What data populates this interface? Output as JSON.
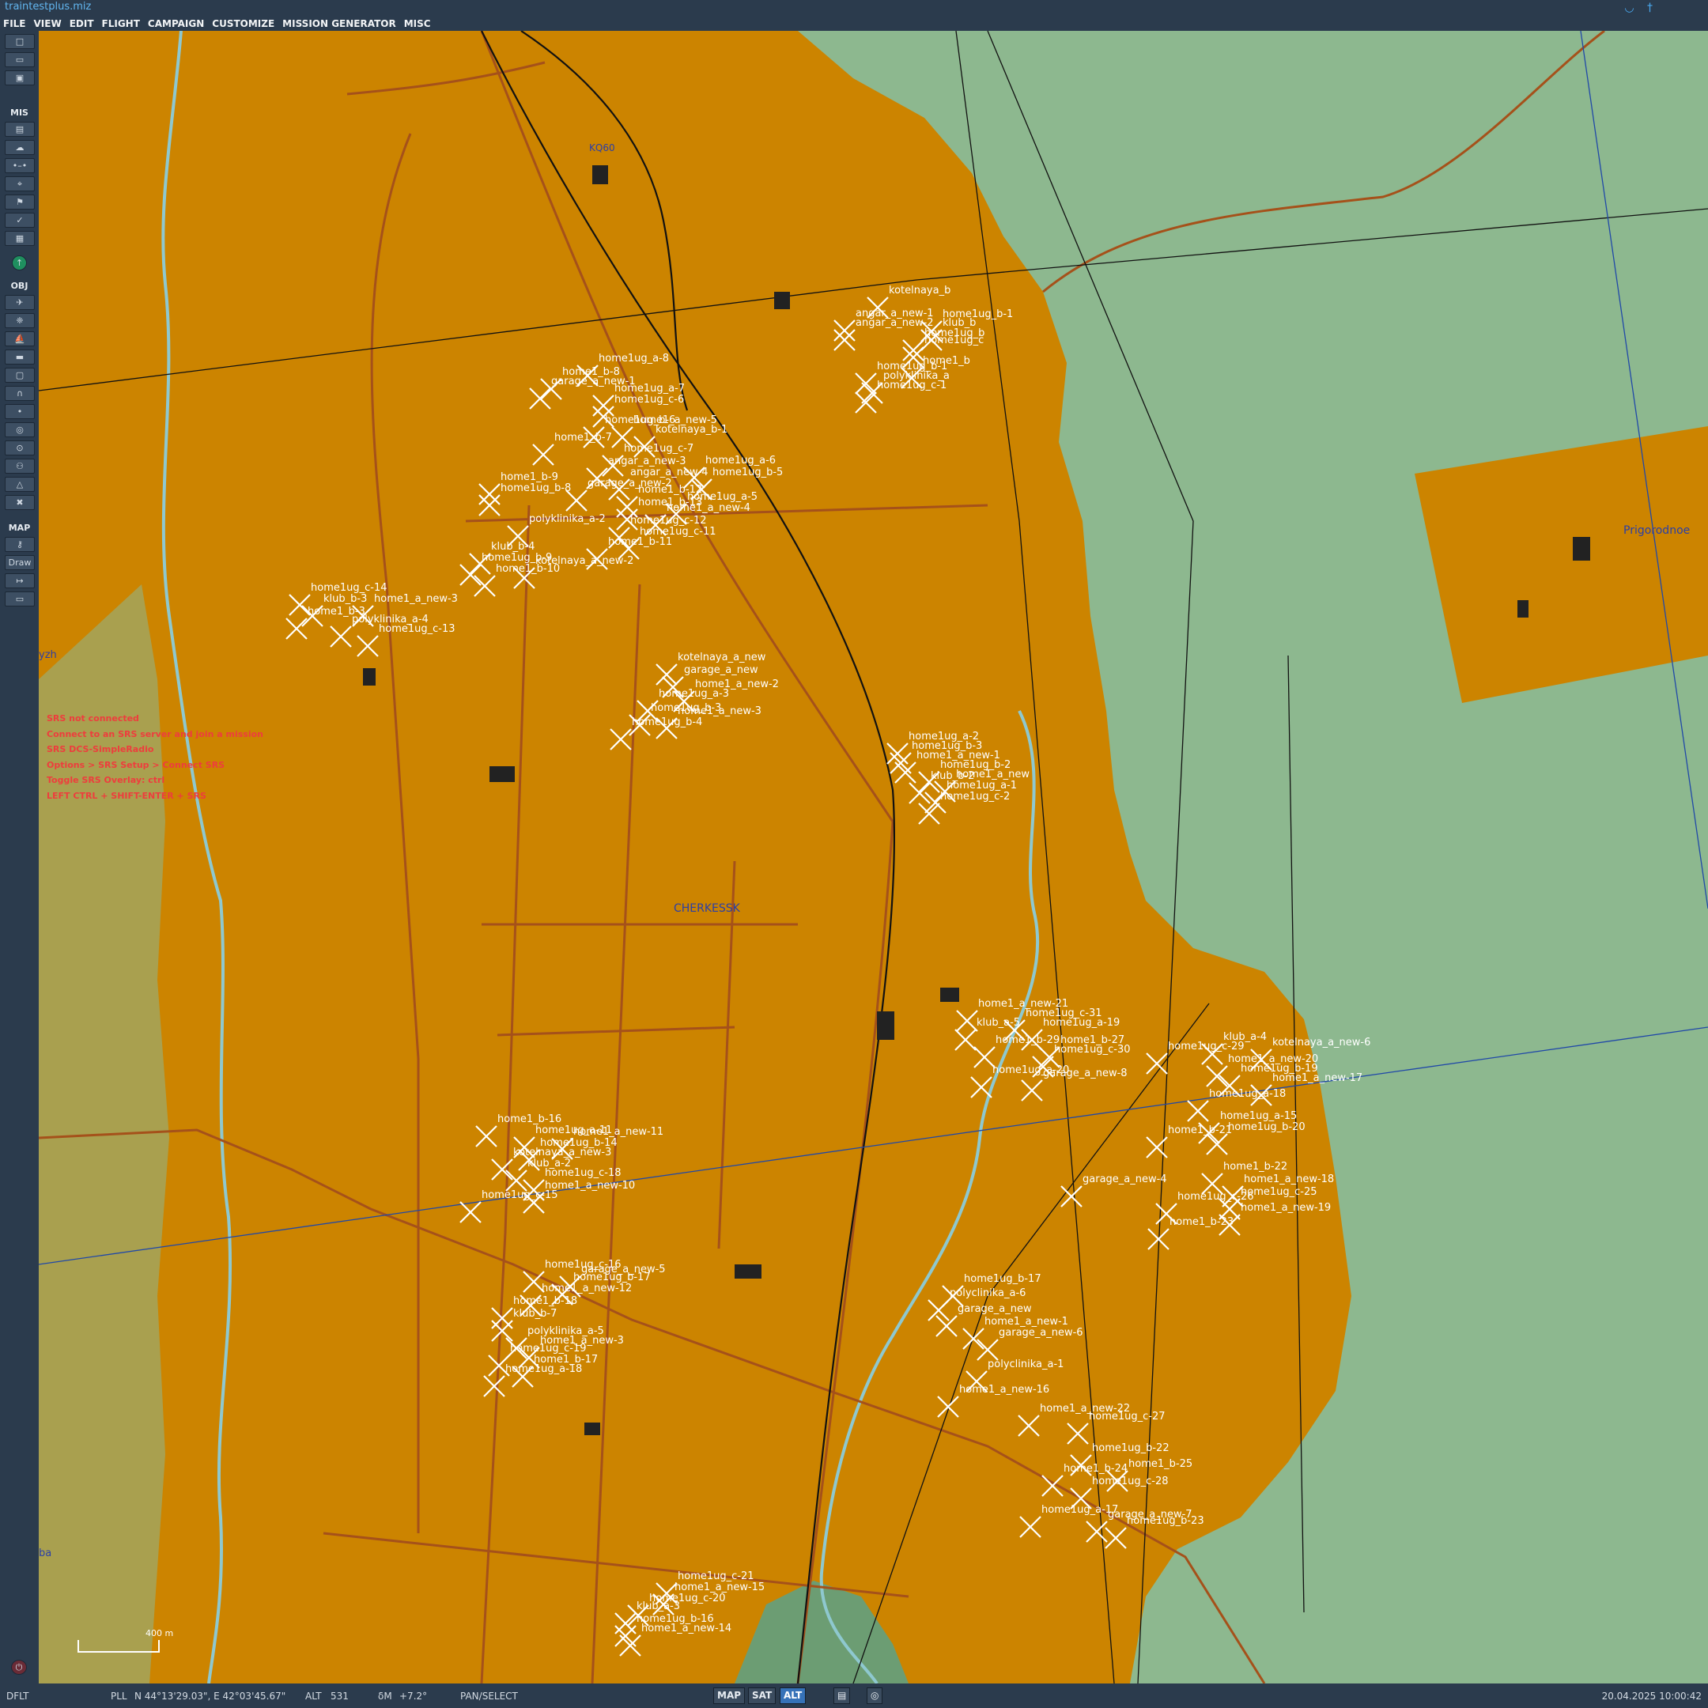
{
  "app": {
    "title": "traintestplus.miz",
    "status_icons": [
      "wifi-icon",
      "antenna-icon"
    ]
  },
  "menu": [
    "FILE",
    "VIEW",
    "EDIT",
    "FLIGHT",
    "CAMPAIGN",
    "CUSTOMIZE",
    "MISSION GENERATOR",
    "MISC"
  ],
  "sidebar": {
    "file_tools": [
      "new-file-icon",
      "open-folder-icon",
      "save-icon"
    ],
    "mis_label": "MIS",
    "mis_tools": [
      "clipboard-icon",
      "weather-cloud-icon",
      "route-icon",
      "target-icon",
      "flag-icon",
      "check-icon",
      "grid-icon",
      "globe-icon"
    ],
    "obj_label": "OBJ",
    "obj_tools": [
      "plane-icon",
      "helicopter-icon",
      "ship-icon",
      "tank-icon",
      "static-object-icon",
      "bridge-icon",
      "waypoint-icon",
      "zone-icon",
      "trigger-zone-icon",
      "group-icon",
      "shapes-icon",
      "delete-icon"
    ],
    "map_label": "MAP",
    "map_key": "key-icon",
    "draw_label": "Draw",
    "map_ruler": "ruler-icon",
    "map_frame": "frame-icon"
  },
  "map": {
    "town_labels": [
      {
        "text": "KQ60"
      },
      {
        "text": "CHERKESSK"
      },
      {
        "text": "Prigorodnoe"
      },
      {
        "text": "yzh"
      },
      {
        "text": "ba"
      }
    ],
    "scale_label": "400 m",
    "objects": [
      {
        "label": "kotelnaya_b"
      },
      {
        "label": "angar_a_new-1"
      },
      {
        "label": "angar_a_new-2"
      },
      {
        "label": "home1ug_b-1"
      },
      {
        "label": "klub_b"
      },
      {
        "label": "home1ug_b"
      },
      {
        "label": "home1ug_c"
      },
      {
        "label": "home1_b"
      },
      {
        "label": "home1ug_b-1"
      },
      {
        "label": "polyklinika_a"
      },
      {
        "label": "home1ug_c-1"
      },
      {
        "label": "home1ug_a-8"
      },
      {
        "label": "home1_b-8"
      },
      {
        "label": "garage_a_new-1"
      },
      {
        "label": "home1ug_a-7"
      },
      {
        "label": "home1ug_c-6"
      },
      {
        "label": "home1_b-7"
      },
      {
        "label": "home1ug_b-6"
      },
      {
        "label": "home1_a_new-5"
      },
      {
        "label": "kotelnaya_b-1"
      },
      {
        "label": "home1ug_c-7"
      },
      {
        "label": "angar_a_new-3"
      },
      {
        "label": "home1ug_a-6"
      },
      {
        "label": "angar_a_new-4"
      },
      {
        "label": "home1ug_b-5"
      },
      {
        "label": "garage_a_new-2"
      },
      {
        "label": "home1_b-9"
      },
      {
        "label": "home1ug_b-8"
      },
      {
        "label": "home1_b-12"
      },
      {
        "label": "home1ug_a-5"
      },
      {
        "label": "home1_b-13"
      },
      {
        "label": "home1_a_new-4"
      },
      {
        "label": "polyklinika_a-2"
      },
      {
        "label": "home1ug_c-12"
      },
      {
        "label": "home1ug_c-11"
      },
      {
        "label": "home1_b-11"
      },
      {
        "label": "klub_b-4"
      },
      {
        "label": "home1ug_b-9"
      },
      {
        "label": "kotelnaya_a_new-2"
      },
      {
        "label": "home1_b-10"
      },
      {
        "label": "home1ug_c-14"
      },
      {
        "label": "klub_b-3"
      },
      {
        "label": "home1_a_new-3"
      },
      {
        "label": "home1_b-3"
      },
      {
        "label": "polyklinika_a-4"
      },
      {
        "label": "home1ug_c-13"
      },
      {
        "label": "kotelnaya_a_new"
      },
      {
        "label": "garage_a_new"
      },
      {
        "label": "home1_a_new-2"
      },
      {
        "label": "home1ug_a-3"
      },
      {
        "label": "home1ug_b-3"
      },
      {
        "label": "home1_a_new-3"
      },
      {
        "label": "home1ug_b-4"
      },
      {
        "label": "home1ug_a-2"
      },
      {
        "label": "home1ug_b-3"
      },
      {
        "label": "home1_a_new-1"
      },
      {
        "label": "home1ug_b-2"
      },
      {
        "label": "home1_a_new"
      },
      {
        "label": "klub_b-2"
      },
      {
        "label": "home1ug_a-1"
      },
      {
        "label": "home1ug_c-2"
      },
      {
        "label": "home1_a_new-21"
      },
      {
        "label": "home1ug_c-31"
      },
      {
        "label": "klub_a-5"
      },
      {
        "label": "home1ug_a-19"
      },
      {
        "label": "home1_b-29"
      },
      {
        "label": "home1_b-27"
      },
      {
        "label": "home1ug_c-30"
      },
      {
        "label": "home1ug_a-20"
      },
      {
        "label": "garage_a_new-8"
      },
      {
        "label": "klub_a-4"
      },
      {
        "label": "kotelnaya_a_new-6"
      },
      {
        "label": "home1ug_c-29"
      },
      {
        "label": "home1_a_new-20"
      },
      {
        "label": "home1ug_b-19"
      },
      {
        "label": "home1_a_new-17"
      },
      {
        "label": "home1ug_a-18"
      },
      {
        "label": "home1ug_a-15"
      },
      {
        "label": "home1ug_b-20"
      },
      {
        "label": "home1_b-21"
      },
      {
        "label": "garage_a_new-4"
      },
      {
        "label": "home1_b-22"
      },
      {
        "label": "home1_a_new-18"
      },
      {
        "label": "home1ug_c-25"
      },
      {
        "label": "home1ug_c-26"
      },
      {
        "label": "home1_a_new-19"
      },
      {
        "label": "home1_b-23"
      },
      {
        "label": "home1_b-16"
      },
      {
        "label": "home1ug_a-11"
      },
      {
        "label": "home1_a_new-11"
      },
      {
        "label": "home1ug_b-14"
      },
      {
        "label": "kotelnaya_a_new-3"
      },
      {
        "label": "klub_a-2"
      },
      {
        "label": "home1ug_c-18"
      },
      {
        "label": "home1_a_new-10"
      },
      {
        "label": "home1ug_c-15"
      },
      {
        "label": "home1ug_c-16"
      },
      {
        "label": "home1ug_b-17"
      },
      {
        "label": "garage_a_new-5"
      },
      {
        "label": "home1_a_new-12"
      },
      {
        "label": "home1_b-18"
      },
      {
        "label": "klub_b-7"
      },
      {
        "label": "polyklinika_a-5"
      },
      {
        "label": "home1_a_new-3"
      },
      {
        "label": "home1ug_c-19"
      },
      {
        "label": "home1_b-17"
      },
      {
        "label": "home1ug_a-18"
      },
      {
        "label": "home1ug_b-17"
      },
      {
        "label": "polyclinika_a-6"
      },
      {
        "label": "garage_a_new"
      },
      {
        "label": "home1_a_new-1"
      },
      {
        "label": "garage_a_new-6"
      },
      {
        "label": "polyclinika_a-1"
      },
      {
        "label": "home1_a_new-16"
      },
      {
        "label": "home1_a_new-22"
      },
      {
        "label": "home1ug_c-27"
      },
      {
        "label": "home1ug_b-22"
      },
      {
        "label": "home1_b-24"
      },
      {
        "label": "home1_b-25"
      },
      {
        "label": "home1ug_c-28"
      },
      {
        "label": "home1ug_a-17"
      },
      {
        "label": "garage_a_new-7"
      },
      {
        "label": "home1ug_b-23"
      },
      {
        "label": "home1ug_c-21"
      },
      {
        "label": "home1_a_new-15"
      },
      {
        "label": "home1ug_c-20"
      },
      {
        "label": "klub_a-3"
      },
      {
        "label": "home1ug_b-16"
      },
      {
        "label": "home1_a_new-14"
      }
    ]
  },
  "srs_messages": [
    "SRS not connected",
    "Connect to an SRS server and join a mission",
    "SRS DCS-SimpleRadio",
    "Options > SRS Setup > Connect SRS",
    "Toggle SRS Overlay: ctrl",
    "LEFT CTRL + SHIFT-ENTER + SRS"
  ],
  "status": {
    "profile": "DFLT",
    "coord_mode": "PLL",
    "coords": "N 44°13'29.03\", E 42°03'45.67\"",
    "alt_label": "ALT",
    "alt_value": "531",
    "dm_label": "δM",
    "dm_value": "+7.2°",
    "mode": "PAN/SELECT",
    "map_buttons": [
      {
        "label": "MAP",
        "active": false
      },
      {
        "label": "SAT",
        "active": false
      },
      {
        "label": "ALT",
        "active": true
      }
    ],
    "datetime": "20.04.2025 10:00:42"
  },
  "colors": {
    "terrain": "#8db88f",
    "urban": "#cc8400",
    "forest": "#5b8f65",
    "river": "#8ec8cf",
    "road": "#a5511a",
    "building": "#222222",
    "label": "#ffffff",
    "chrome": "#2b3b4d",
    "accent": "#62b6f0",
    "srs_text": "#ee3d3d"
  }
}
